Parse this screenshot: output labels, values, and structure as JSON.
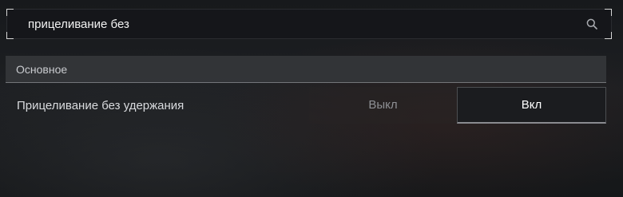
{
  "search": {
    "value": "прицеливание без",
    "icon": "search-icon"
  },
  "section": {
    "title": "Основное"
  },
  "setting": {
    "label": "Прицеливание без удержания",
    "options": [
      "Выкл",
      "Вкл"
    ],
    "selected": "Вкл"
  }
}
